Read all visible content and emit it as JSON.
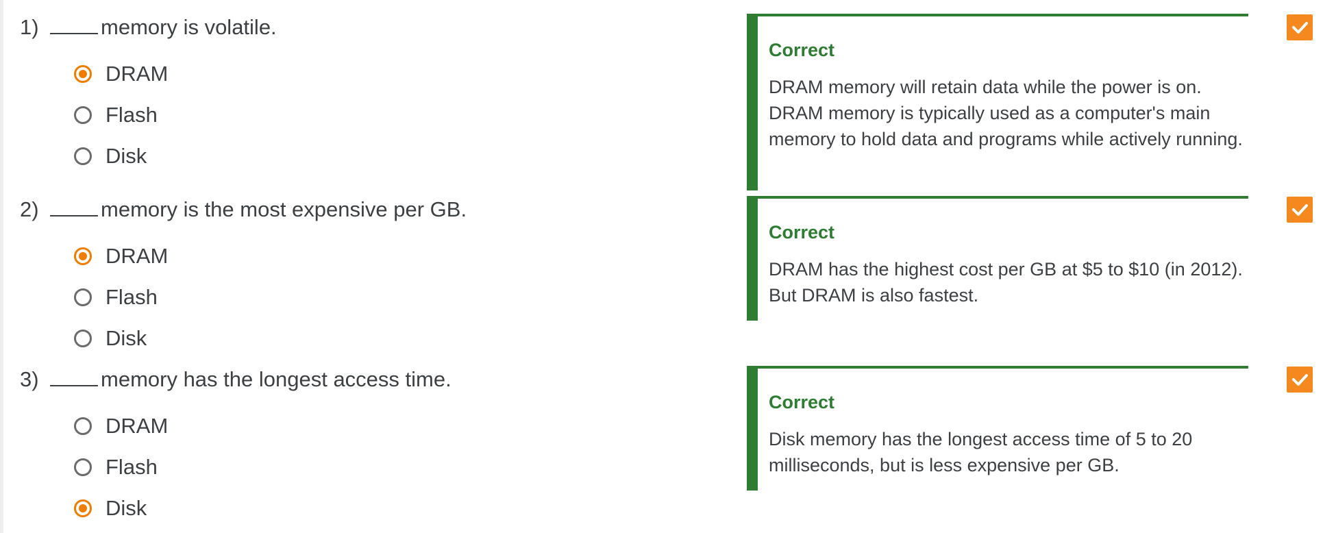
{
  "questions": [
    {
      "number": "1)",
      "text": "memory is volatile.",
      "choices": [
        {
          "label": "DRAM",
          "selected": true
        },
        {
          "label": "Flash",
          "selected": false
        },
        {
          "label": "Disk",
          "selected": false
        }
      ],
      "feedback": {
        "title": "Correct",
        "text": "DRAM memory will retain data while the power is on. DRAM memory is typically used as a computer's main memory to hold data and programs while actively running."
      },
      "status_icon": "checkmark-icon"
    },
    {
      "number": "2)",
      "text": "memory is the most expensive per GB.",
      "choices": [
        {
          "label": "DRAM",
          "selected": true
        },
        {
          "label": "Flash",
          "selected": false
        },
        {
          "label": "Disk",
          "selected": false
        }
      ],
      "feedback": {
        "title": "Correct",
        "text": "DRAM has the highest cost per GB at $5 to $10 (in 2012). But DRAM is also fastest."
      },
      "status_icon": "checkmark-icon"
    },
    {
      "number": "3)",
      "text": "memory has the longest access time.",
      "choices": [
        {
          "label": "DRAM",
          "selected": false
        },
        {
          "label": "Flash",
          "selected": false
        },
        {
          "label": "Disk",
          "selected": true
        }
      ],
      "feedback": {
        "title": "Correct",
        "text": "Disk memory has the longest access time of 5 to 20 milliseconds, but is less expensive per GB."
      },
      "status_icon": "checkmark-icon"
    }
  ],
  "colors": {
    "accent": "#f07d00",
    "correct_green": "#2e7d32",
    "status_orange": "#f5891f",
    "text": "#3c4043"
  }
}
